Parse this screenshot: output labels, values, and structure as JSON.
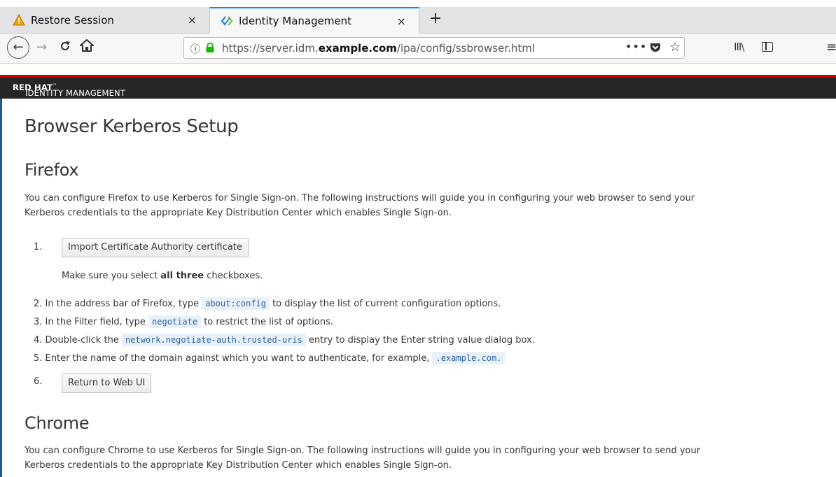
{
  "top_strip": {
    "text": ""
  },
  "tabs": [
    {
      "title": "Restore Session",
      "close": "×"
    },
    {
      "title": "Identity Management",
      "close": "×"
    }
  ],
  "new_tab": "+",
  "nav": {
    "url_prefix": "https://server.idm.",
    "url_domain": "example.com",
    "url_path": "/ipa/config/ssbrowser.html",
    "page_actions": "•••"
  },
  "banner": {
    "brand": "RED HAT",
    "product": "IDENTITY MANAGEMENT"
  },
  "page": {
    "title": "Browser Kerberos Setup",
    "firefox": {
      "heading": "Firefox",
      "intro_line1": "You can configure Firefox to use Kerberos for Single Sign-on. The following instructions will guide you in configuring your web browser to send your",
      "intro_line2": "Kerberos credentials to the appropriate Key Distribution Center which enables Single Sign-on.",
      "step1_num": "1.",
      "import_button": "Import Certificate Authority certificate",
      "select_note_pre": "Make sure you select ",
      "select_note_bold": "all three",
      "select_note_post": " checkboxes.",
      "step2_pre": "2. In the address bar of Firefox, type ",
      "step2_code": "about:config",
      "step2_post": " to display the list of current configuration options.",
      "step3_pre": "3. In the Filter field, type ",
      "step3_code": "negotiate",
      "step3_post": " to restrict the list of options.",
      "step4_pre": "4. Double-click the ",
      "step4_code": "network.negotiate-auth.trusted-uris",
      "step4_post": " entry to display the Enter string value dialog box.",
      "step5_pre": "5. Enter the name of the domain against which you want to authenticate, for example, ",
      "step5_code": ".example.com.",
      "step6_num": "6.",
      "return_button": "Return to Web UI"
    },
    "chrome": {
      "heading": "Chrome",
      "intro_line1": "You can configure Chrome to use Kerberos for Single Sign-on. The following instructions will guide you in configuring your web browser to send your",
      "intro_line2": "Kerberos credentials to the appropriate Key Distribution Center which enables Single Sign-on."
    }
  }
}
